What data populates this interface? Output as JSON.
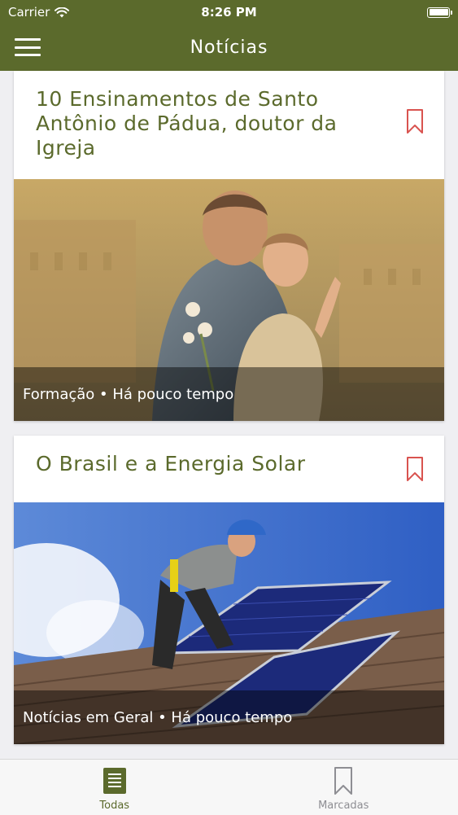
{
  "status": {
    "carrier": "Carrier",
    "time": "8:26 PM"
  },
  "header": {
    "title": "Notícias"
  },
  "articles": [
    {
      "title": "10 Ensinamentos de Santo Antônio de Pádua, doutor da Igreja",
      "meta": "Formação • Há pouco tempo",
      "image": "statue of Saint Anthony holding child Jesus"
    },
    {
      "title": "O Brasil e a Energia Solar",
      "meta": "Notícias em Geral • Há pouco tempo",
      "image": "worker installing solar panels on roof"
    }
  ],
  "tabs": [
    {
      "label": "Todas",
      "icon": "document-icon",
      "active": true
    },
    {
      "label": "Marcadas",
      "icon": "bookmark-icon",
      "active": false
    }
  ],
  "colors": {
    "brand": "#5b6a2c",
    "bookmark": "#d9534f"
  }
}
